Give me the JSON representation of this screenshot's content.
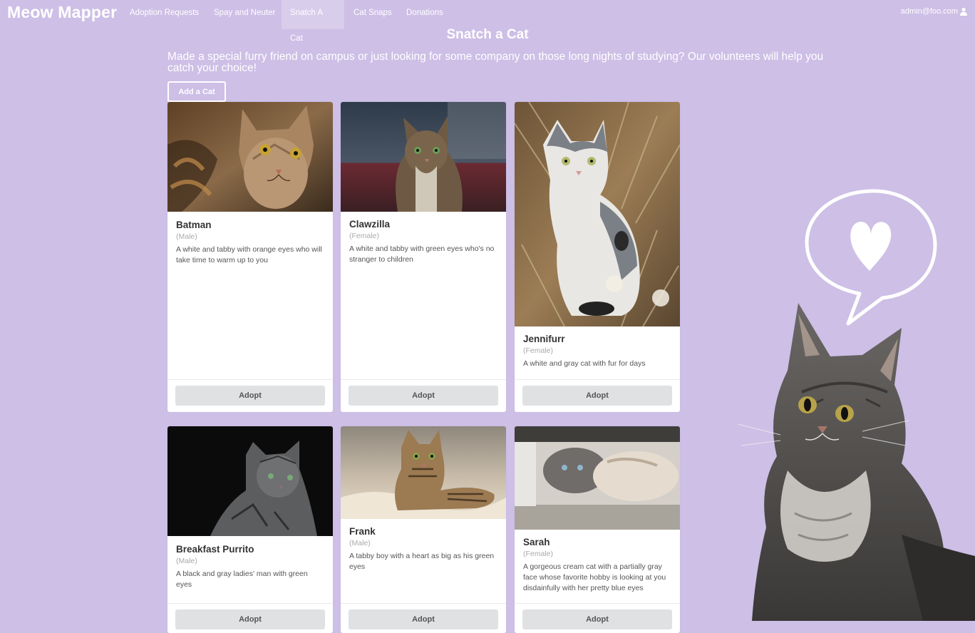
{
  "nav": {
    "brand": "Meow Mapper",
    "items": [
      "Adoption Requests",
      "Spay and Neuter",
      "Snatch A Cat",
      "Cat Snaps",
      "Donations"
    ],
    "active": "Snatch A Cat",
    "user": "admin@foo.com",
    "user_icon": "user-icon"
  },
  "page": {
    "title": "Snatch a Cat",
    "intro": "Made a special furry friend on campus or just looking for some company on those long nights of studying? Our volunteers will help you catch your choice!",
    "add_button": "Add a Cat"
  },
  "cats": [
    {
      "name": "Batman",
      "sex": "(Male)",
      "description": "A white and tabby with orange eyes who will take time to warm up to you",
      "adopt_label": "Adopt"
    },
    {
      "name": "Clawzilla",
      "sex": "(Female)",
      "description": "A white and tabby with green eyes who's no stranger to children",
      "adopt_label": "Adopt"
    },
    {
      "name": "Jennifurr",
      "sex": "(Female)",
      "description": "A white and gray cat with fur for days",
      "adopt_label": "Adopt"
    },
    {
      "name": "Breakfast Purrito",
      "sex": "(Male)",
      "description": "A black and gray ladies' man with green eyes",
      "adopt_label": "Adopt"
    },
    {
      "name": "Frank",
      "sex": "(Male)",
      "description": "A tabby boy with a heart as big as his green eyes",
      "adopt_label": "Adopt"
    },
    {
      "name": "Sarah",
      "sex": "(Female)",
      "description": "A gorgeous cream cat with a partially gray face whose favorite hobby is looking at you disdainfully with her pretty blue eyes",
      "adopt_label": "Adopt"
    }
  ],
  "colors": {
    "background": "#cdbfe6",
    "button": "#e0e1e2"
  }
}
